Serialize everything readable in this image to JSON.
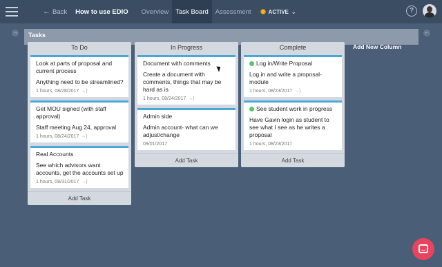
{
  "topbar": {
    "back_label": "Back",
    "back_icon": "arrow-left-icon",
    "title": "How to use EDIO",
    "tabs": [
      {
        "label": "Overview",
        "active": false
      },
      {
        "label": "Task Board",
        "active": true
      },
      {
        "label": "Assessment",
        "active": false
      }
    ],
    "status_label": "ACTIVE",
    "status_color": "#f0b429",
    "help_icon": "?"
  },
  "board": {
    "section_title": "Tasks",
    "add_column_label": "Add New Column",
    "columns": [
      {
        "title": "To Do",
        "add_task_label": "Add Task",
        "cards": [
          {
            "title": "Look at parts of proposal and current process",
            "description": "Anything need to be streamlined?",
            "meta": "1 hours, 08/28/2017",
            "done": false
          },
          {
            "title": "Get MOU signed (with staff approval)",
            "description": "Staff meeting Aug 24, approval",
            "meta": "1 hours, 08/24/2017",
            "done": false
          },
          {
            "title": "Real Accounts",
            "description": "See which advisors want accounts, get the accounts set up",
            "meta": "1 hours, 08/31/2017",
            "done": false
          }
        ]
      },
      {
        "title": "In Progress",
        "add_task_label": "Add Task",
        "cards": [
          {
            "title": "Document with comments",
            "description": "Create a document with comments, things that may be hard as is",
            "meta": "1 hours, 08/24/2017",
            "done": false
          },
          {
            "title": "Admin side",
            "description": "Admin account- what can we adjust/change",
            "meta": "09/01/2017",
            "done": false
          }
        ]
      },
      {
        "title": "Complete",
        "add_task_label": "Add Task",
        "cards": [
          {
            "title": "Log in/Write Proposal",
            "description": "Log in and write a proposal- module",
            "meta": "1 hours, 08/23/2017",
            "done": true
          },
          {
            "title": "See student work in progress",
            "description": "Have Gavin login as student to see what I see as he writes a proposal",
            "meta": "1 hours, 08/23/2017",
            "done": true
          }
        ]
      }
    ]
  },
  "colors": {
    "background": "#4a5e77",
    "topbar": "#3b4d63",
    "card_accent": "#4aa8d8",
    "done_dot": "#5cc46a",
    "chat": "#e8445e"
  }
}
